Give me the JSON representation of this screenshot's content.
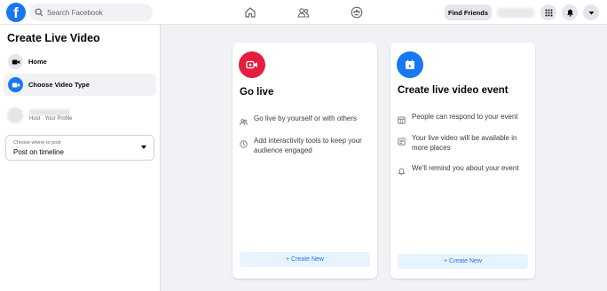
{
  "topbar": {
    "logo_letter": "f",
    "search_placeholder": "Search Facebook",
    "nav_icons": [
      "home-icon",
      "friends-icon",
      "groups-icon"
    ],
    "find_friends_label": "Find Friends",
    "right_icons": [
      "menu-grid-icon",
      "notifications-bell-icon",
      "account-caret-icon"
    ]
  },
  "sidebar": {
    "title": "Create Live Video",
    "items": [
      {
        "label": "Home",
        "icon": "video-camera-icon",
        "active": false
      },
      {
        "label": "Choose Video Type",
        "icon": "video-camera-icon",
        "active": true
      }
    ],
    "host": {
      "role": "Host · Your Profile"
    },
    "post_select": {
      "label": "Choose where to post",
      "value": "Post on timeline"
    }
  },
  "cards": [
    {
      "title": "Go live",
      "icon": "live-camera-icon",
      "icon_color": "#e41e3f",
      "features": [
        {
          "icon": "people-icon",
          "text": "Go live by yourself or with others"
        },
        {
          "icon": "clock-icon",
          "text": "Add interactivity tools to keep your audience engaged"
        }
      ],
      "button_label": "+ Create New"
    },
    {
      "title": "Create live video event",
      "icon": "calendar-event-icon",
      "icon_color": "#1877f2",
      "features": [
        {
          "icon": "calendar-grid-icon",
          "text": "People can respond to your event"
        },
        {
          "icon": "list-icon",
          "text": "Your live video will be available in more places"
        },
        {
          "icon": "bell-icon",
          "text": "We'll remind you about your event"
        }
      ],
      "button_label": "+ Create New"
    }
  ],
  "colors": {
    "brand_blue": "#1877f2",
    "live_red": "#e41e3f",
    "background": "#f0f2f5"
  }
}
